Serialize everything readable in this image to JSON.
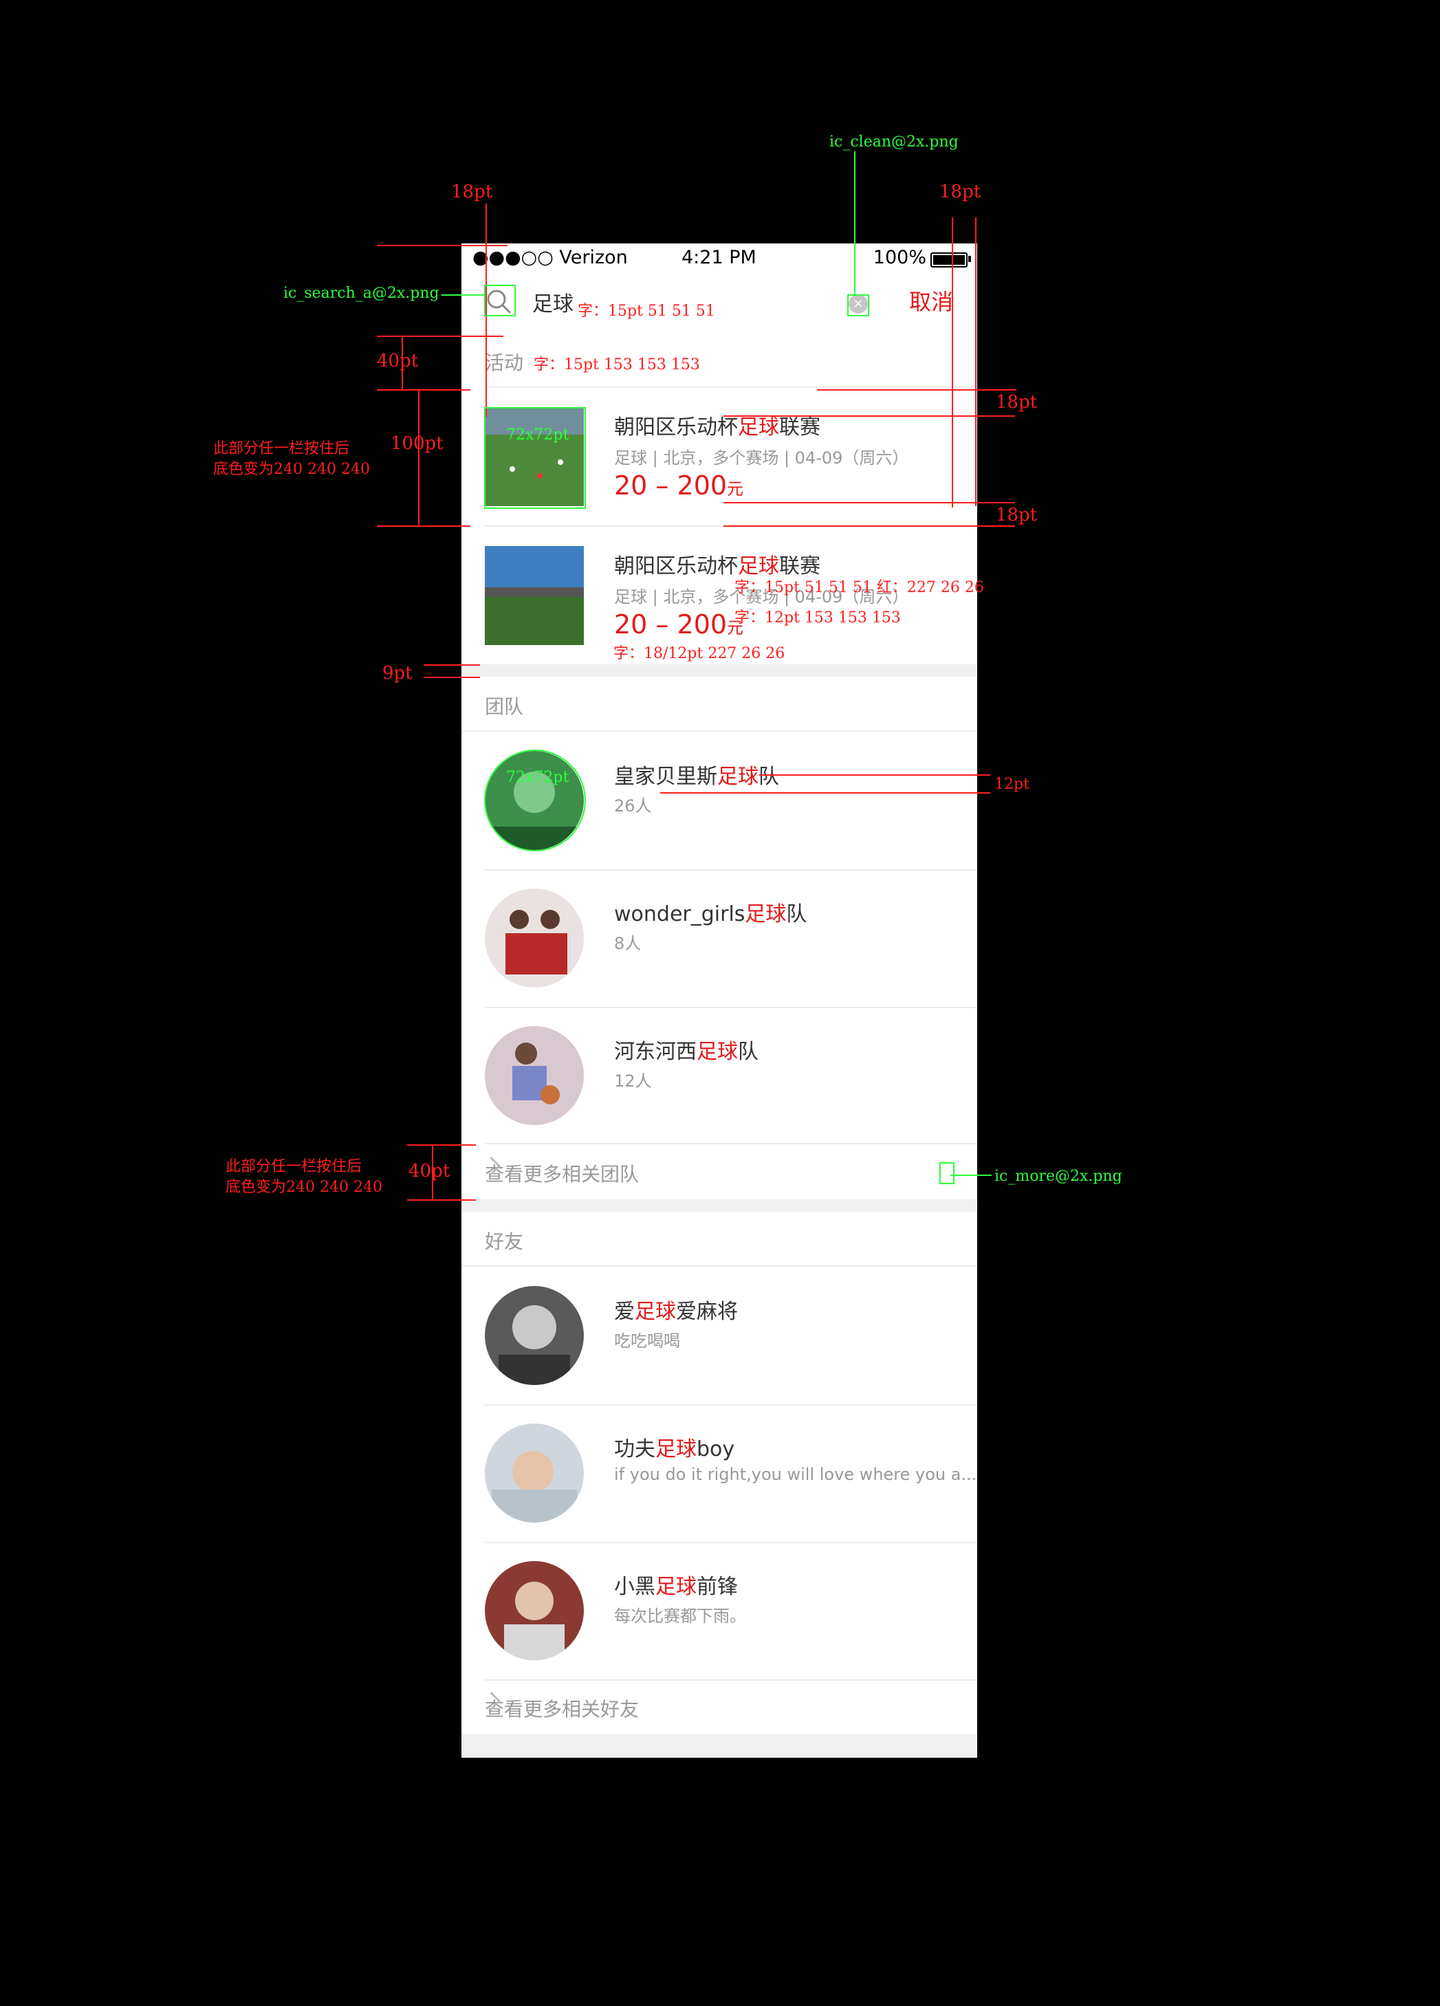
{
  "status": {
    "carrier": "●●●○○ Verizon",
    "time": "4:21 PM",
    "battery": "100%"
  },
  "search": {
    "query": "足球",
    "cancel": "取消"
  },
  "activities": {
    "header": "活动",
    "items": [
      {
        "title_pre": "朝阳区乐动杯",
        "title_hl": "足球",
        "title_post": "联赛",
        "sub": "足球 | 北京，多个赛场 | 04-09（周六）",
        "price": "20 – 200",
        "unit": "元"
      },
      {
        "title_pre": "朝阳区乐动杯",
        "title_hl": "足球",
        "title_post": "联赛",
        "sub": "足球 | 北京，多个赛场 | 04-09（周六）",
        "price": "20 – 200",
        "unit": "元"
      }
    ]
  },
  "teams": {
    "header": "团队",
    "items": [
      {
        "name_pre": "皇家贝里斯",
        "name_hl": "足球",
        "name_post": "队",
        "sub": "26人"
      },
      {
        "name_pre": "wonder_girls",
        "name_hl": "足球",
        "name_post": "队",
        "sub": "8人"
      },
      {
        "name_pre": "河东河西",
        "name_hl": "足球",
        "name_post": "队",
        "sub": "12人"
      }
    ],
    "more": "查看更多相关团队"
  },
  "friends": {
    "header": "好友",
    "items": [
      {
        "name_pre": "爱",
        "name_hl": "足球",
        "name_post": "爱麻将",
        "sub": "吃吃喝喝"
      },
      {
        "name_pre": "功夫",
        "name_hl": "足球",
        "name_post": "boy",
        "sub": "if you do it right,you will love where you a..."
      },
      {
        "name_pre": "小黑",
        "name_hl": "足球",
        "name_post": "前锋",
        "sub": "每次比赛都下雨。"
      }
    ],
    "more": "查看更多相关好友"
  },
  "annotations": {
    "pt18_left": "18pt",
    "pt18_right": "18pt",
    "pt18_r2": "18pt",
    "pt18_r3": "18pt",
    "clean_png": "ic_clean@2x.png",
    "search_png": "ic_search_a@2x.png",
    "search_font": "字：15pt 51 51 51",
    "section_font": "字：15pt 153 153 153",
    "pt40": "40pt",
    "pt100": "100pt",
    "press_note1": "此部分任一栏按住后",
    "press_note2": "底色变为240 240 240",
    "size72_a": "72x72pt",
    "title_font": "字：15pt 51 51 51  红：227 26 26",
    "sub_font": "字：12pt 153 153 153",
    "price_font": "字：18/12pt 227 26 26",
    "pt9": "9pt",
    "size72_b": "72x72pt",
    "pt12": "12pt",
    "press_note3": "此部分任一栏按住后",
    "press_note4": "底色变为240 240 240",
    "pt40b": "40pt",
    "more_png": "ic_more@2x.png"
  },
  "colors": {
    "red": "#e31a1a",
    "annotation_red": "#ff1e1e",
    "annotation_green": "#2dff3a",
    "bg_gray": "#f0f0f0"
  }
}
